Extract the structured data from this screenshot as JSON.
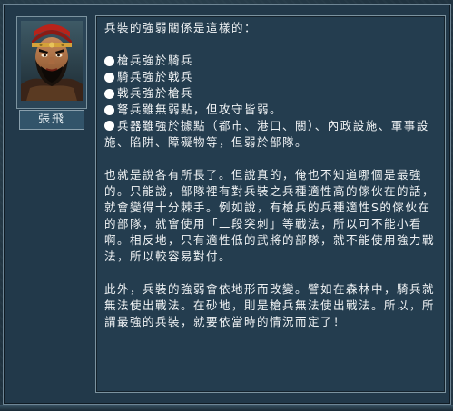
{
  "character": {
    "name": "張飛"
  },
  "dialog": {
    "intro": "兵裝的強弱關係是這樣的：",
    "bullets": [
      "槍兵強於騎兵",
      "騎兵強於戟兵",
      "戟兵強於槍兵",
      "弩兵雖無弱點，但攻守皆弱。",
      "兵器雖強於據點（都市、港口、關）、內政設施、軍事設施、陷阱、障礙物等，但弱於部隊。"
    ],
    "paragraph1": "也就是說各有所長了。但說真的，俺也不知道哪個是最強的。只能說，部隊裡有對兵裝之兵種適性高的傢伙在的話，就會變得十分棘手。例如說，有槍兵的兵種適性S的傢伙在的部隊，就會使用「二段突刺」等戰法，所以可不能小看啊。相反地，只有適性低的武將的部隊，就不能使用強力戰法，所以較容易對付。",
    "paragraph2": "此外，兵裝的強弱會依地形而改變。譬如在森林中，騎兵就無法使出戰法。在砂地，則是槍兵無法使出戰法。所以，所謂最強的兵裝，就要依當時的情況而定了！"
  }
}
